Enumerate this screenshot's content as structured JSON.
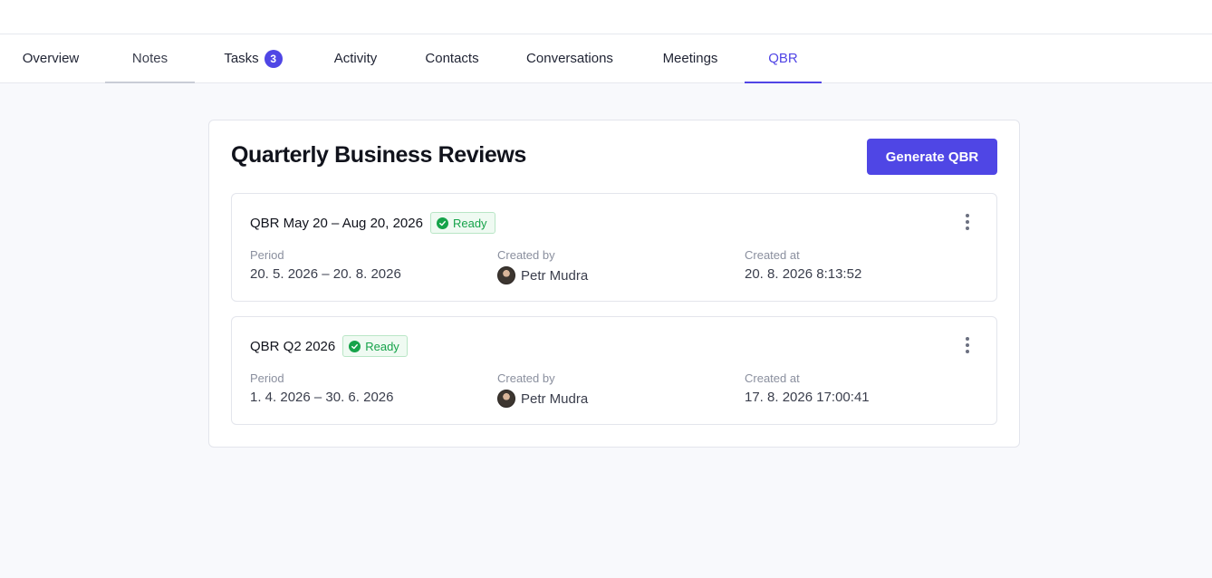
{
  "tabs": [
    {
      "label": "Overview"
    },
    {
      "label": "Notes"
    },
    {
      "label": "Tasks",
      "badge": "3"
    },
    {
      "label": "Activity"
    },
    {
      "label": "Contacts"
    },
    {
      "label": "Conversations"
    },
    {
      "label": "Meetings"
    },
    {
      "label": "QBR"
    }
  ],
  "active_tab": "QBR",
  "panel": {
    "title": "Quarterly Business Reviews",
    "generate_button": "Generate QBR"
  },
  "reviews": [
    {
      "title": "QBR May 20 – Aug 20, 2026",
      "status": "Ready",
      "period_label": "Period",
      "period": "20. 5. 2026 – 20. 8. 2026",
      "created_by_label": "Created by",
      "created_by": "Petr Mudra",
      "created_at_label": "Created at",
      "created_at": "20. 8. 2026 8:13:52"
    },
    {
      "title": "QBR Q2 2026",
      "status": "Ready",
      "period_label": "Period",
      "period": "1. 4. 2026 – 30. 6. 2026",
      "created_by_label": "Created by",
      "created_by": "Petr Mudra",
      "created_at_label": "Created at",
      "created_at": "17. 8. 2026 17:00:41"
    }
  ],
  "colors": {
    "accent": "#4f46e5",
    "ready_green": "#16a34a",
    "background": "#f8f9fc"
  }
}
